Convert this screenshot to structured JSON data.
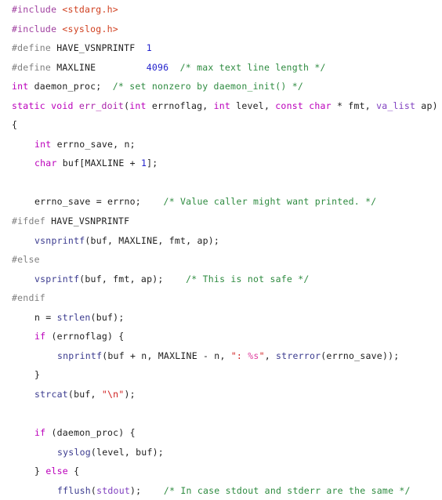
{
  "editor": {
    "language": "C",
    "background_color": "#ffffff",
    "font_size_px": 11.5,
    "line_height_px": 24.55
  },
  "colors": {
    "preprocessor": "#808080",
    "include_directive": "#a040a0",
    "header_name": "#d04020",
    "keyword": "#bb00bb",
    "function_definition": "#aa22aa",
    "function_call": "#3b3b8f",
    "constant_type": "#8040c0",
    "number": "#2222cc",
    "string": "#d02020",
    "format_specifier": "#e040a0",
    "comment": "#2e8b40",
    "plain_text": "#202020"
  },
  "code": {
    "lines": [
      {
        "indent": 0,
        "tokens": [
          {
            "t": "ppinc",
            "s": "#include"
          },
          {
            "t": "plain",
            "s": " "
          },
          {
            "t": "header",
            "s": "<stdarg.h>"
          }
        ]
      },
      {
        "indent": 0,
        "tokens": [
          {
            "t": "ppinc",
            "s": "#include"
          },
          {
            "t": "plain",
            "s": " "
          },
          {
            "t": "header",
            "s": "<syslog.h>"
          }
        ]
      },
      {
        "indent": 0,
        "tokens": [
          {
            "t": "pp",
            "s": "#define"
          },
          {
            "t": "plain",
            "s": " "
          },
          {
            "t": "macro",
            "s": "HAVE_VSNPRINTF"
          },
          {
            "t": "plain",
            "s": "  "
          },
          {
            "t": "num",
            "s": "1"
          }
        ]
      },
      {
        "indent": 0,
        "tokens": [
          {
            "t": "pp",
            "s": "#define"
          },
          {
            "t": "plain",
            "s": " "
          },
          {
            "t": "macro",
            "s": "MAXLINE"
          },
          {
            "t": "plain",
            "s": "         "
          },
          {
            "t": "num",
            "s": "4096"
          },
          {
            "t": "plain",
            "s": "  "
          },
          {
            "t": "cmt",
            "s": "/* max text line length */"
          }
        ]
      },
      {
        "indent": 0,
        "tokens": [
          {
            "t": "kw",
            "s": "int"
          },
          {
            "t": "plain",
            "s": " daemon_proc;  "
          },
          {
            "t": "cmt",
            "s": "/* set nonzero by daemon_init() */"
          }
        ]
      },
      {
        "indent": 0,
        "tokens": [
          {
            "t": "kw",
            "s": "static"
          },
          {
            "t": "plain",
            "s": " "
          },
          {
            "t": "kw",
            "s": "void"
          },
          {
            "t": "plain",
            "s": " "
          },
          {
            "t": "fnname",
            "s": "err_doit"
          },
          {
            "t": "plain",
            "s": "("
          },
          {
            "t": "kw",
            "s": "int"
          },
          {
            "t": "plain",
            "s": " errnoflag, "
          },
          {
            "t": "kw",
            "s": "int"
          },
          {
            "t": "plain",
            "s": " level, "
          },
          {
            "t": "kw",
            "s": "const"
          },
          {
            "t": "plain",
            "s": " "
          },
          {
            "t": "kw",
            "s": "char"
          },
          {
            "t": "plain",
            "s": " * fmt, "
          },
          {
            "t": "const",
            "s": "va_list"
          },
          {
            "t": "plain",
            "s": " ap)"
          }
        ]
      },
      {
        "indent": 0,
        "tokens": [
          {
            "t": "plain",
            "s": "{"
          }
        ]
      },
      {
        "indent": 1,
        "tokens": [
          {
            "t": "kw",
            "s": "int"
          },
          {
            "t": "plain",
            "s": " errno_save, n;"
          }
        ]
      },
      {
        "indent": 1,
        "tokens": [
          {
            "t": "kw",
            "s": "char"
          },
          {
            "t": "plain",
            "s": " buf[MAXLINE + "
          },
          {
            "t": "num",
            "s": "1"
          },
          {
            "t": "plain",
            "s": "];"
          }
        ]
      },
      {
        "indent": 0,
        "tokens": []
      },
      {
        "indent": 1,
        "tokens": [
          {
            "t": "plain",
            "s": "errno_save = errno;    "
          },
          {
            "t": "cmt",
            "s": "/* Value caller might want printed. */"
          }
        ]
      },
      {
        "indent": 0,
        "tokens": [
          {
            "t": "pp",
            "s": "#ifdef"
          },
          {
            "t": "plain",
            "s": " "
          },
          {
            "t": "macro",
            "s": "HAVE_VSNPRINTF"
          }
        ]
      },
      {
        "indent": 1,
        "tokens": [
          {
            "t": "call",
            "s": "vsnprintf"
          },
          {
            "t": "plain",
            "s": "(buf, MAXLINE, fmt, ap);"
          }
        ]
      },
      {
        "indent": 0,
        "tokens": [
          {
            "t": "pp",
            "s": "#else"
          }
        ]
      },
      {
        "indent": 1,
        "tokens": [
          {
            "t": "call",
            "s": "vsprintf"
          },
          {
            "t": "plain",
            "s": "(buf, fmt, ap);    "
          },
          {
            "t": "cmt",
            "s": "/* This is not safe */"
          }
        ]
      },
      {
        "indent": 0,
        "tokens": [
          {
            "t": "pp",
            "s": "#endif"
          }
        ]
      },
      {
        "indent": 1,
        "tokens": [
          {
            "t": "plain",
            "s": "n = "
          },
          {
            "t": "call",
            "s": "strlen"
          },
          {
            "t": "plain",
            "s": "(buf);"
          }
        ]
      },
      {
        "indent": 1,
        "tokens": [
          {
            "t": "kw",
            "s": "if"
          },
          {
            "t": "plain",
            "s": " (errnoflag) {"
          }
        ]
      },
      {
        "indent": 2,
        "tokens": [
          {
            "t": "call",
            "s": "snprintf"
          },
          {
            "t": "plain",
            "s": "(buf + n, MAXLINE - n, "
          },
          {
            "t": "str",
            "s": "\": "
          },
          {
            "t": "fmt",
            "s": "%s"
          },
          {
            "t": "str",
            "s": "\""
          },
          {
            "t": "plain",
            "s": ", "
          },
          {
            "t": "call",
            "s": "strerror"
          },
          {
            "t": "plain",
            "s": "(errno_save));"
          }
        ]
      },
      {
        "indent": 1,
        "tokens": [
          {
            "t": "plain",
            "s": "}"
          }
        ]
      },
      {
        "indent": 1,
        "tokens": [
          {
            "t": "call",
            "s": "strcat"
          },
          {
            "t": "plain",
            "s": "(buf, "
          },
          {
            "t": "str",
            "s": "\""
          },
          {
            "t": "esc",
            "s": "\\n"
          },
          {
            "t": "str",
            "s": "\""
          },
          {
            "t": "plain",
            "s": ");"
          }
        ]
      },
      {
        "indent": 0,
        "tokens": []
      },
      {
        "indent": 1,
        "tokens": [
          {
            "t": "kw",
            "s": "if"
          },
          {
            "t": "plain",
            "s": " (daemon_proc) {"
          }
        ]
      },
      {
        "indent": 2,
        "tokens": [
          {
            "t": "call",
            "s": "syslog"
          },
          {
            "t": "plain",
            "s": "(level, buf);"
          }
        ]
      },
      {
        "indent": 1,
        "tokens": [
          {
            "t": "plain",
            "s": "} "
          },
          {
            "t": "kw",
            "s": "else"
          },
          {
            "t": "plain",
            "s": " {"
          }
        ]
      },
      {
        "indent": 2,
        "tokens": [
          {
            "t": "call",
            "s": "fflush"
          },
          {
            "t": "plain",
            "s": "("
          },
          {
            "t": "const",
            "s": "stdout"
          },
          {
            "t": "plain",
            "s": ");    "
          },
          {
            "t": "cmt",
            "s": "/* In case stdout and stderr are the same */"
          }
        ]
      }
    ]
  }
}
